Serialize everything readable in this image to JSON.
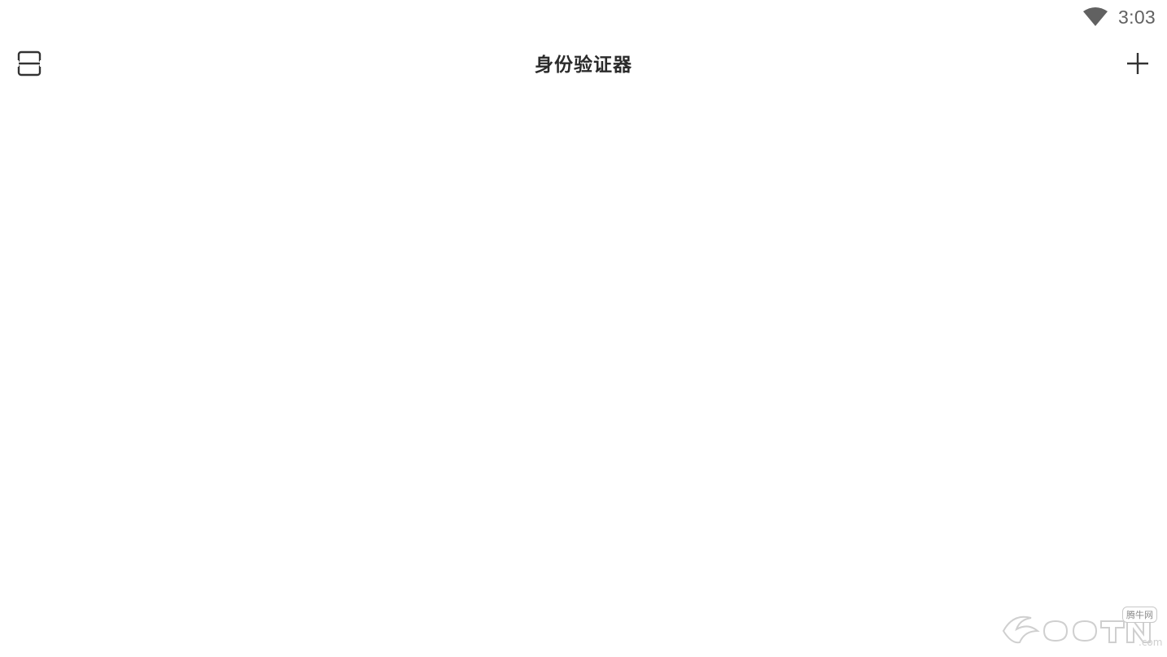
{
  "status_bar": {
    "time": "3:03",
    "wifi_icon": "wifi-icon"
  },
  "app_bar": {
    "title": "身份验证器",
    "left_icon": "scan-icon",
    "right_icon": "plus-icon"
  },
  "watermark": {
    "site": "腾牛网"
  },
  "colors": {
    "background": "#ffffff",
    "title": "#2b2b2b",
    "status": "#616161",
    "icon": "#333333"
  }
}
